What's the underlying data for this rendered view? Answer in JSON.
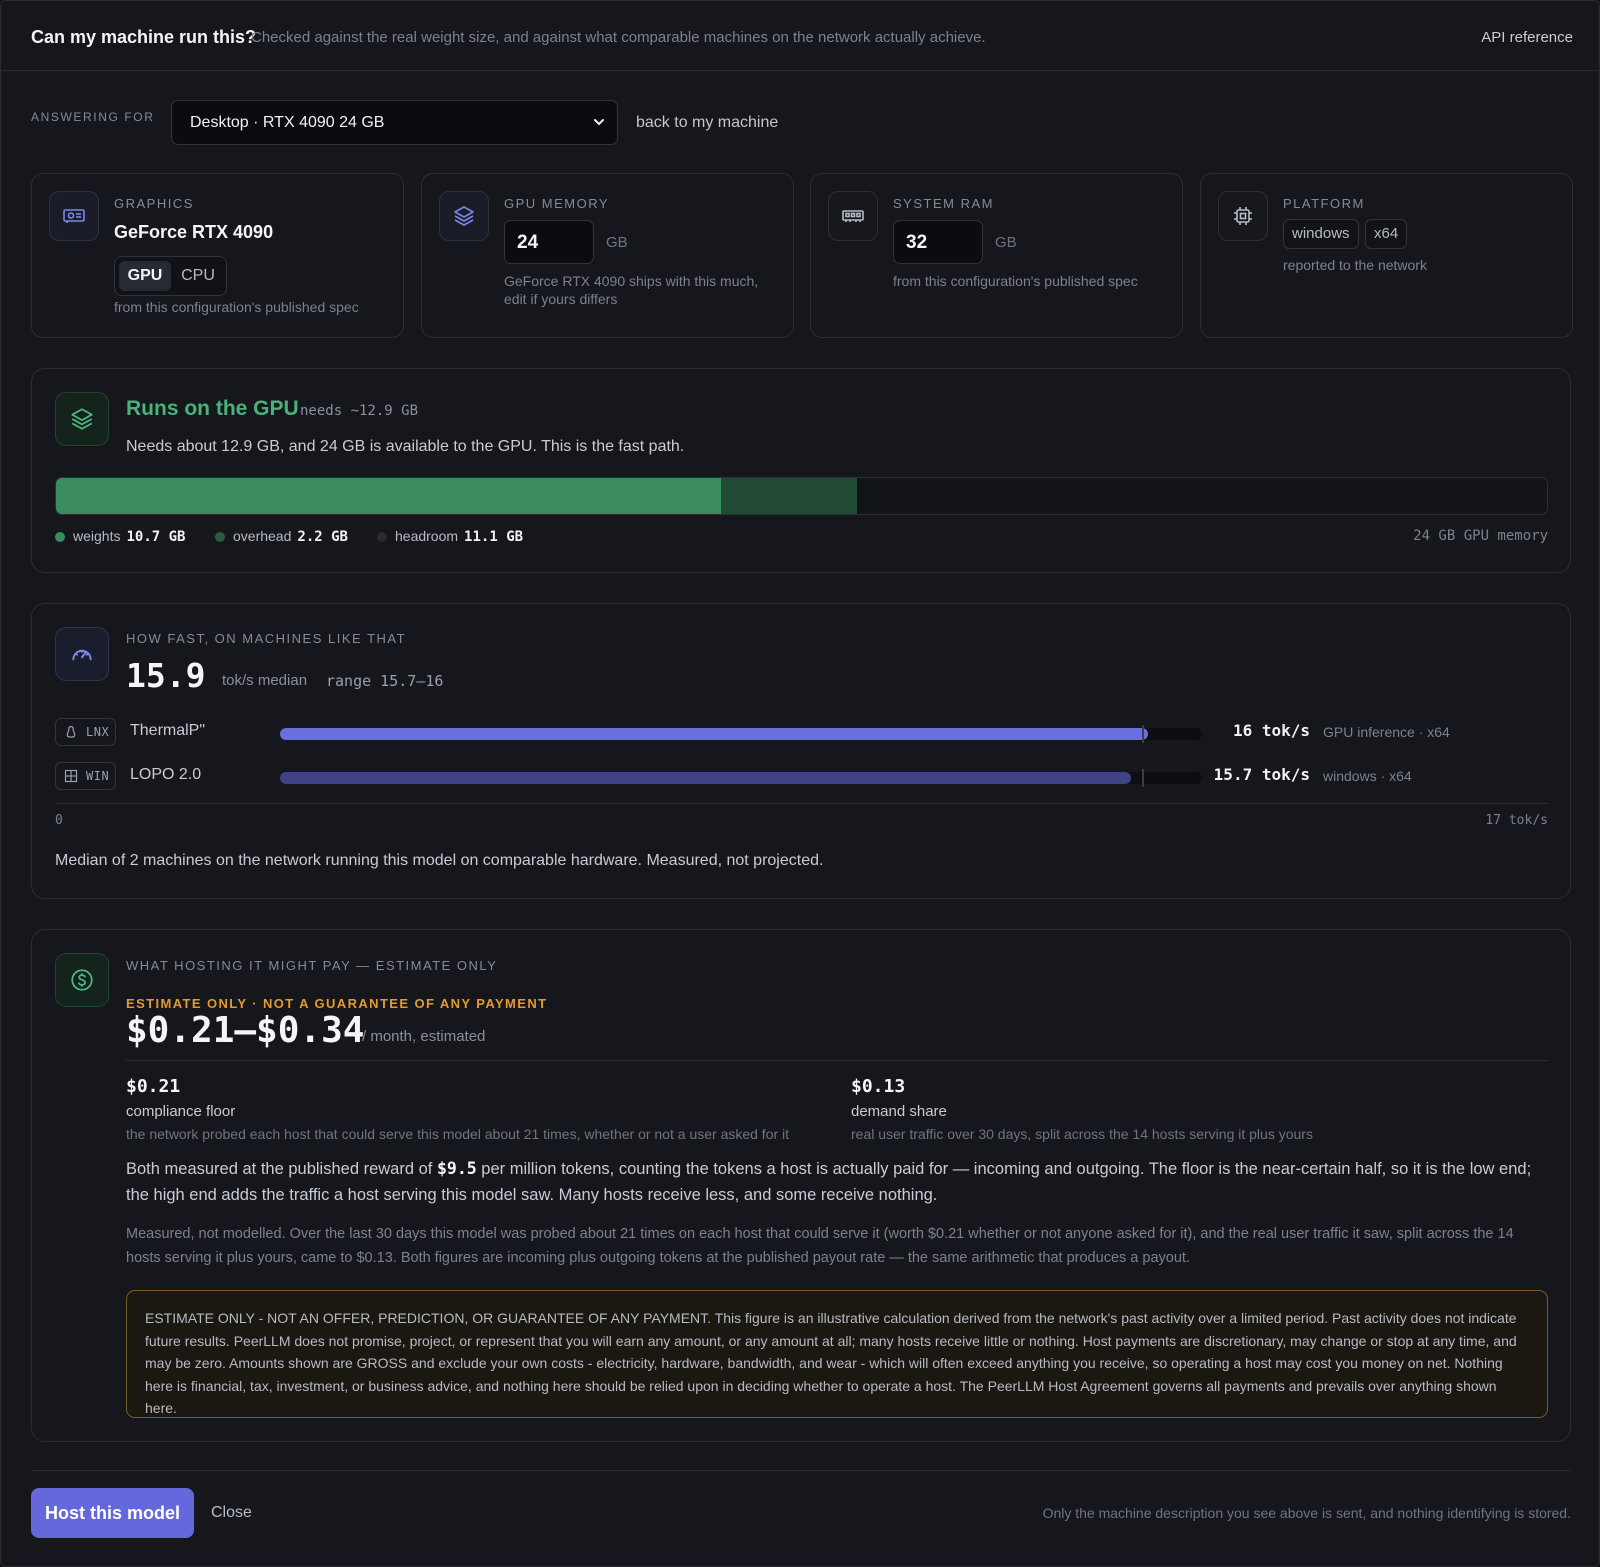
{
  "header": {
    "title": "Can my machine run this?",
    "subtitle": "Checked against the real weight size, and against what comparable machines on the network actually achieve.",
    "api_link": "API reference"
  },
  "answering": {
    "label": "ANSWERING FOR",
    "selected": "Desktop · RTX 4090 24 GB",
    "back_link": "back to my machine"
  },
  "specs": {
    "graphics": {
      "label": "GRAPHICS",
      "title": "GeForce RTX 4090",
      "gpu_label": "GPU",
      "cpu_label": "CPU",
      "note": "from this configuration's published spec",
      "icon": "gpu-card-icon"
    },
    "gpu_memory": {
      "label": "GPU MEMORY",
      "value": "24",
      "unit": "GB",
      "note": "GeForce RTX 4090 ships with this much, edit if yours differs",
      "icon": "layers-icon"
    },
    "system_ram": {
      "label": "SYSTEM RAM",
      "value": "32",
      "unit": "GB",
      "note": "from this configuration's published spec",
      "icon": "ram-icon"
    },
    "platform": {
      "label": "PLATFORM",
      "os": "windows",
      "arch": "x64",
      "note": "reported to the network",
      "icon": "chip-icon"
    }
  },
  "fit": {
    "title": "Runs on the GPU",
    "needs": "needs ~12.9 GB",
    "description": "Needs about 12.9 GB, and 24 GB is available to the GPU. This is the fast path.",
    "capacity_gb": 24,
    "segments": [
      {
        "name": "weights",
        "gb": 10.7,
        "label": "10.7 GB",
        "color": "#3a8c5c"
      },
      {
        "name": "overhead",
        "gb": 2.2,
        "label": "2.2 GB",
        "color": "#214a34"
      },
      {
        "name": "headroom",
        "gb": 11.1,
        "label": "11.1 GB",
        "color": "#121418"
      }
    ],
    "legend_dots": [
      "#3a8c5c",
      "#2a5c40",
      "#272a31"
    ],
    "capacity_label": "24 GB GPU memory"
  },
  "speed": {
    "label": "HOW FAST, ON MACHINES LIKE THAT",
    "median": "15.9",
    "median_unit": "tok/s median",
    "range": "range 15.7–16",
    "axis_max": 17,
    "axis_min_label": "0",
    "axis_max_label": "17 tok/s",
    "median_value": 15.9,
    "machines": [
      {
        "os_badge": "LNX",
        "os_icon": "linux-icon",
        "name": "ThermalP\"",
        "value": 16,
        "value_label": "16 tok/s",
        "meta": "GPU inference · x64",
        "color": "#6a6fe0"
      },
      {
        "os_badge": "WIN",
        "os_icon": "windows-icon",
        "name": "LOPO 2.0",
        "value": 15.7,
        "value_label": "15.7 tok/s",
        "meta": "windows · x64",
        "color": "#3f4384"
      }
    ],
    "footer": "Median of 2 machines on the network running this model on comparable hardware. Measured, not projected."
  },
  "earnings": {
    "label": "WHAT HOSTING IT MIGHT PAY — ESTIMATE ONLY",
    "warning": "ESTIMATE ONLY · NOT A GUARANTEE OF ANY PAYMENT",
    "range": "$0.21–$0.34",
    "unit": "/ month, estimated",
    "components": [
      {
        "value": "$0.21",
        "label": "compliance floor",
        "note": "the network probed each host that could serve this model about 21 times, whether or not a user asked for it"
      },
      {
        "value": "$0.13",
        "label": "demand share",
        "note": "real user traffic over 30 days, split across the 14 hosts serving it plus yours"
      }
    ],
    "para_pre": "Both measured at the published reward of ",
    "para_rate": "$9.5",
    "para_post": " per million tokens, counting the tokens a host is actually paid for — incoming and outgoing. The floor is the near-certain half, so it is the low end; the high end adds the traffic a host serving this model saw. Many hosts receive less, and some receive nothing.",
    "para2": "Measured, not modelled. Over the last 30 days this model was probed about 21 times on each host that could serve it (worth $0.21 whether or not anyone asked for it), and the real user traffic it saw, split across the 14 hosts serving it plus yours, came to $0.13. Both figures are incoming plus outgoing tokens at the published payout rate — the same arithmetic that produces a payout.",
    "disclaimer": "ESTIMATE ONLY - NOT AN OFFER, PREDICTION, OR GUARANTEE OF ANY PAYMENT. This figure is an illustrative calculation derived from the network's past activity over a limited period. Past activity does not indicate future results. PeerLLM does not promise, project, or represent that you will earn any amount, or any amount at all; many hosts receive little or nothing. Host payments are discretionary, may change or stop at any time, and may be zero. Amounts shown are GROSS and exclude your own costs - electricity, hardware, bandwidth, and wear - which will often exceed anything you receive, so operating a host may cost you money on net. Nothing here is financial, tax, investment, or business advice, and nothing here should be relied upon in deciding whether to operate a host. The PeerLLM Host Agreement governs all payments and prevails over anything shown here."
  },
  "footer": {
    "host_button": "Host this model",
    "close_button": "Close",
    "note": "Only the machine description you see above is sent, and nothing identifying is stored."
  }
}
